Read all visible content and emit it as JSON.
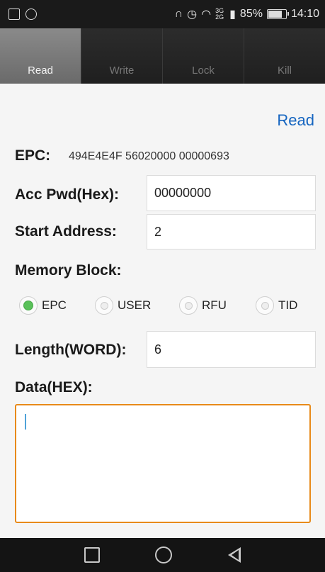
{
  "status_bar": {
    "left_icons": [
      "image-icon",
      "camera-icon"
    ],
    "right_icons": [
      "headphones-icon",
      "alarm-icon",
      "wifi-icon",
      "signal-icon"
    ],
    "network": "3G 2G",
    "battery_percent": "85%",
    "battery_level": 0.85,
    "time": "14:10"
  },
  "tabs": [
    {
      "label": "Read",
      "active": true
    },
    {
      "label": "Write",
      "active": false
    },
    {
      "label": "Lock",
      "active": false
    },
    {
      "label": "Kill",
      "active": false
    }
  ],
  "form": {
    "read_button": "Read",
    "epc_label": "EPC:",
    "epc_value": "494E4E4F 56020000 00000693",
    "acc_pwd_label": "Acc Pwd(Hex):",
    "acc_pwd_value": "00000000",
    "start_address_label": "Start Address:",
    "start_address_value": "2",
    "memory_block_label": "Memory Block:",
    "memory_block_options": [
      {
        "label": "EPC",
        "checked": true
      },
      {
        "label": "USER",
        "checked": false
      },
      {
        "label": "RFU",
        "checked": false
      },
      {
        "label": "TID",
        "checked": false
      }
    ],
    "length_label": "Length(WORD):",
    "length_value": "6",
    "data_label": "Data(HEX):",
    "data_value": ""
  },
  "navbar": {
    "icons": [
      "recent-apps-icon",
      "home-icon",
      "back-icon"
    ]
  },
  "colors": {
    "link": "#1565c0",
    "textarea_border": "#e88a1a",
    "radio_checked": "#5ac15a"
  }
}
